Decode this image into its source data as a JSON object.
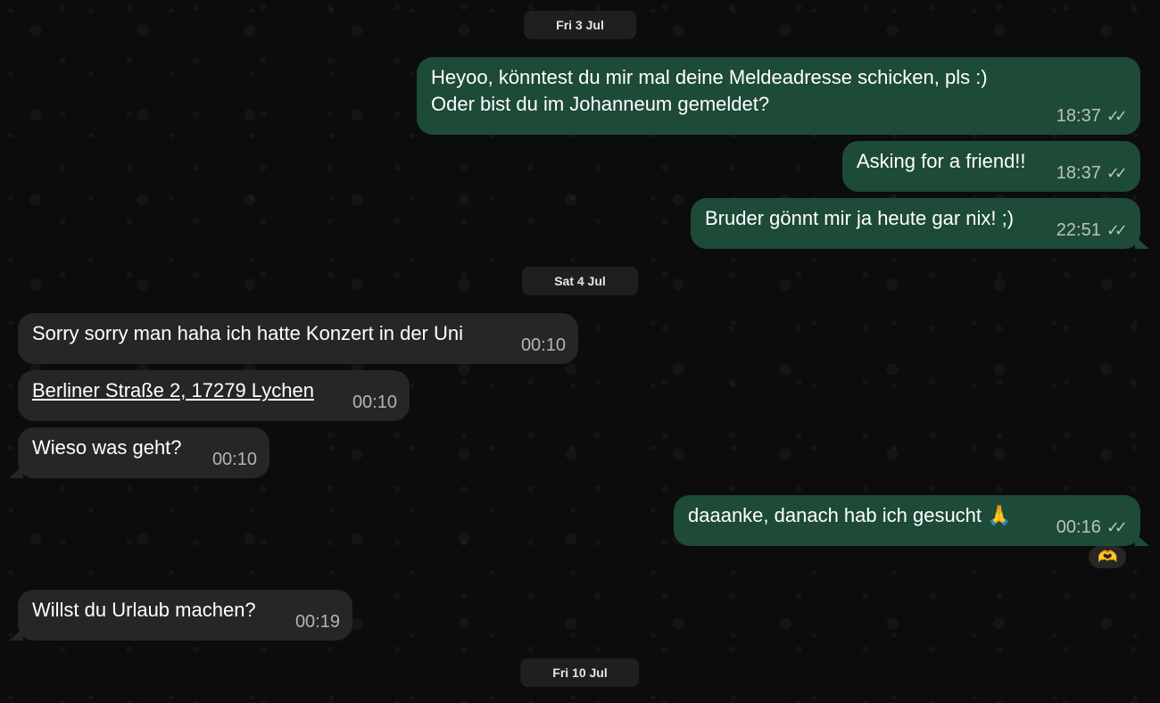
{
  "dates": {
    "d1": "Fri 3 Jul",
    "d2": "Sat 4 Jul",
    "d3": "Fri 10 Jul"
  },
  "messages": [
    {
      "dir": "out",
      "text": "Heyoo, könntest du mir mal deine Meldeadresse schicken, pls :)\nOder bist du im Johanneum gemeldet?",
      "time": "18:37",
      "ticks": "✓✓"
    },
    {
      "dir": "out",
      "text": "Asking for a friend!!",
      "time": "18:37",
      "ticks": "✓✓"
    },
    {
      "dir": "out",
      "text": "Bruder gönnt mir ja heute gar nix! ;)",
      "time": "22:51",
      "ticks": "✓✓"
    },
    {
      "dir": "in",
      "text": "Sorry sorry man haha ich hatte Konzert in der Uni",
      "time": "00:10"
    },
    {
      "dir": "in",
      "text": "Berliner Straße 2, 17279 Lychen",
      "time": "00:10"
    },
    {
      "dir": "in",
      "text": "Wieso was geht?",
      "time": "00:10"
    },
    {
      "dir": "out",
      "text": "daaanke, danach hab ich gesucht 🙏",
      "time": "00:16",
      "ticks": "✓✓",
      "reaction": "🫶"
    },
    {
      "dir": "in",
      "text": "Willst du Urlaub machen?",
      "time": "00:19"
    }
  ],
  "colors": {
    "outgoing_bubble": "#1e4a38",
    "incoming_bubble": "#262626",
    "background": "#0c0c0c"
  }
}
